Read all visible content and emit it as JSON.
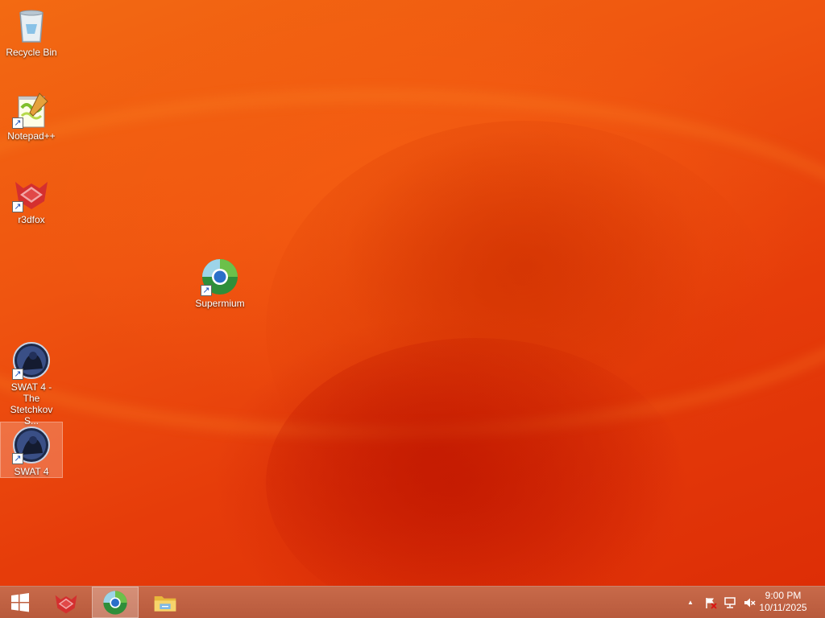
{
  "desktop": {
    "icons": [
      {
        "label": "Recycle Bin",
        "icon": "recycle-bin-icon"
      },
      {
        "label": "Notepad++",
        "icon": "notepad-plus-plus-icon"
      },
      {
        "label": "r3dfox",
        "icon": "r3dfox-icon"
      },
      {
        "label": "Supermium",
        "icon": "supermium-icon"
      },
      {
        "label": "SWAT 4 - The Stetchkov S...",
        "icon": "swat4-stetchkov-icon"
      },
      {
        "label": "SWAT 4",
        "icon": "swat4-icon",
        "selected": true
      }
    ],
    "shortcut_arrow": "↗"
  },
  "taskbar": {
    "start": "start-icon",
    "pinned": [
      "r3dfox-icon",
      "supermium-icon",
      "file-explorer-icon"
    ],
    "active": "supermium-icon",
    "tray": {
      "show_hidden": "▲",
      "flag_icon": "action-center-flag-icon",
      "network_icon": "network-icon",
      "volume_icon": "volume-muted-icon"
    },
    "clock": {
      "time": "9:00 PM",
      "date": "10/11/2025"
    }
  },
  "colors": {
    "wallpaper": "#ef5410",
    "taskbar": "#c0644a"
  }
}
